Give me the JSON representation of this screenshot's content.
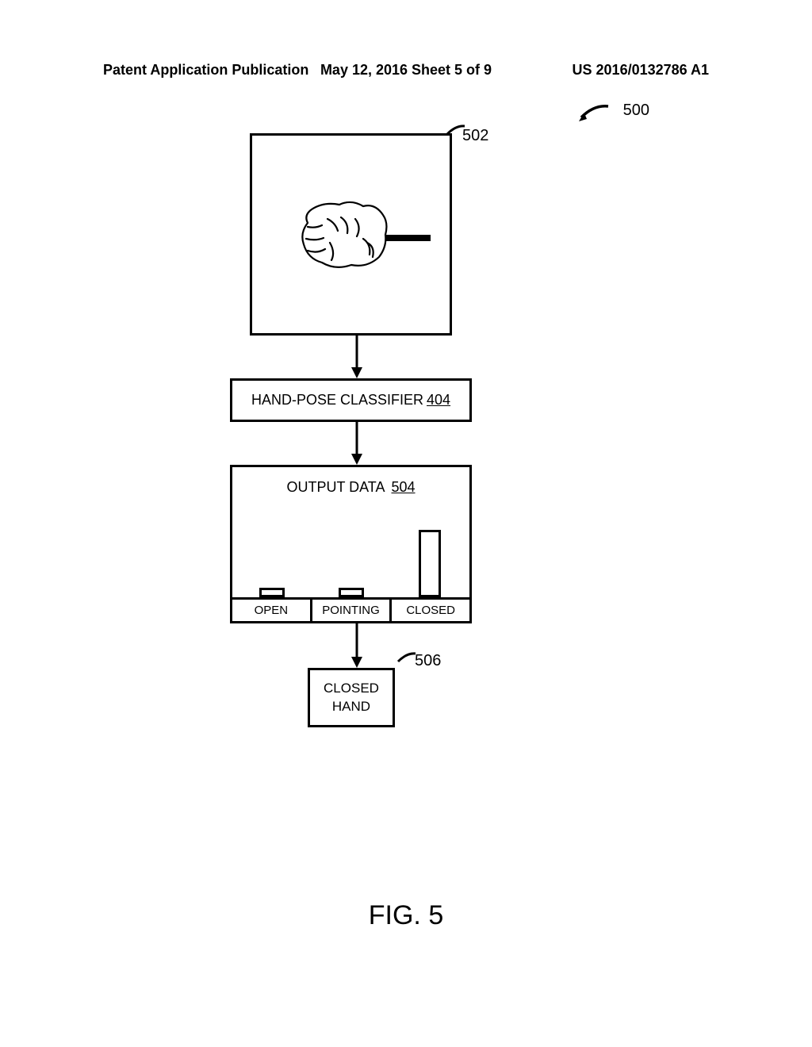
{
  "header": {
    "left": "Patent Application Publication",
    "center": "May 12, 2016  Sheet 5 of 9",
    "right": "US 2016/0132786 A1"
  },
  "figure": {
    "overall_ref": "500",
    "input_ref": "502",
    "classifier": {
      "label": "HAND-POSE CLASSIFIER",
      "ref": "404"
    },
    "output": {
      "label": "OUTPUT DATA",
      "ref": "504",
      "categories": [
        "OPEN",
        "POINTING",
        "CLOSED"
      ]
    },
    "result": {
      "line1": "CLOSED",
      "line2": "HAND",
      "ref": "506"
    },
    "caption": "FIG. 5"
  },
  "chart_data": {
    "type": "bar",
    "categories": [
      "OPEN",
      "POINTING",
      "CLOSED"
    ],
    "values": [
      12,
      12,
      85
    ],
    "title": "OUTPUT DATA 504",
    "xlabel": "",
    "ylabel": "",
    "ylim": [
      0,
      100
    ]
  }
}
